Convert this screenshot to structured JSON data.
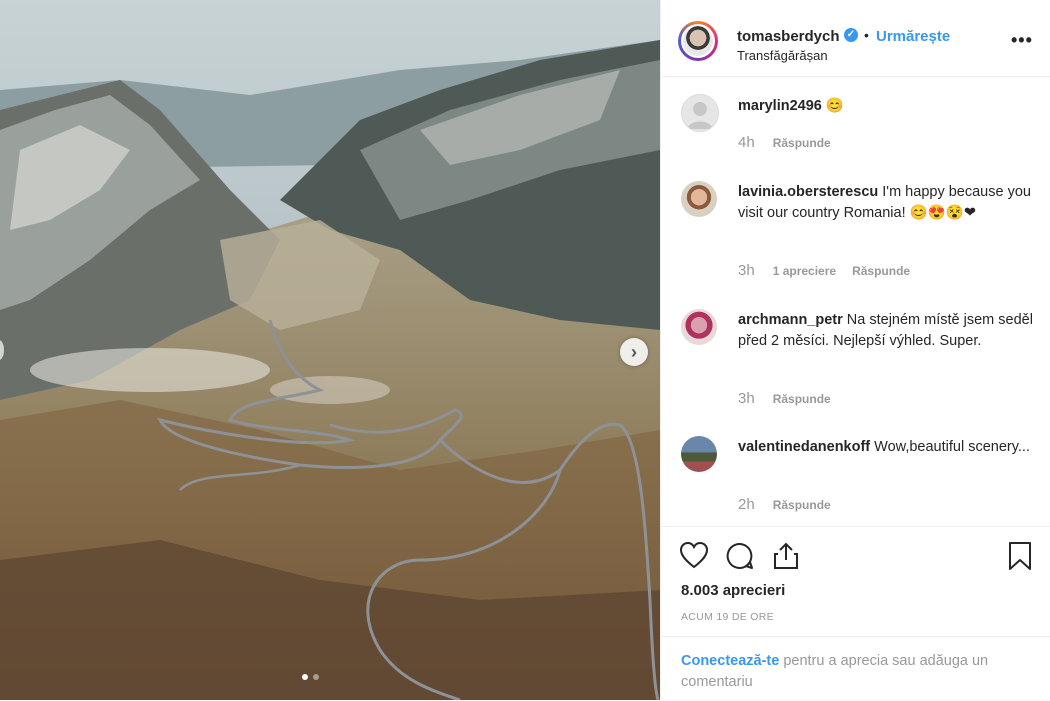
{
  "post": {
    "username": "tomasberdych",
    "verified_mark": "✓",
    "separator": "•",
    "follow_label": "Urmărește",
    "location": "Transfăgărășan",
    "more_label": "•••",
    "next_label": "›"
  },
  "comments": [
    {
      "username": "marylin2496",
      "text": "",
      "emoji": "😊",
      "time": "4h",
      "likes": "",
      "reply_label": "Răspunde"
    },
    {
      "username": "lavinia.obersterescu",
      "text": "I'm happy because you visit our country Romania!",
      "emoji": "😊😍😵❤",
      "time": "3h",
      "likes": "1 apreciere",
      "reply_label": "Răspunde"
    },
    {
      "username": "archmann_petr",
      "text": "Na stejném místě jsem seděl před 2 měsíci. Nejlepší výhled. Super.",
      "emoji": "",
      "time": "3h",
      "likes": "",
      "reply_label": "Răspunde"
    },
    {
      "username": "valentinedanenkoff",
      "text": "Wow,beautiful scenery...",
      "emoji": "",
      "time": "2h",
      "likes": "",
      "reply_label": "Răspunde"
    }
  ],
  "footer": {
    "likes": "8.003 aprecieri",
    "posted_ago": "ACUM 19 DE ORE",
    "login_link": "Conectează-te",
    "login_rest": " pentru a aprecia sau adăuga un comentariu"
  },
  "icons": {
    "like": "heart-icon",
    "comment": "comment-icon",
    "share": "share-icon",
    "save": "bookmark-icon"
  },
  "colors": {
    "accent": "#3897f0",
    "meta": "#999999",
    "text": "#262626"
  },
  "carousel": {
    "slides": 2,
    "active": 1
  }
}
